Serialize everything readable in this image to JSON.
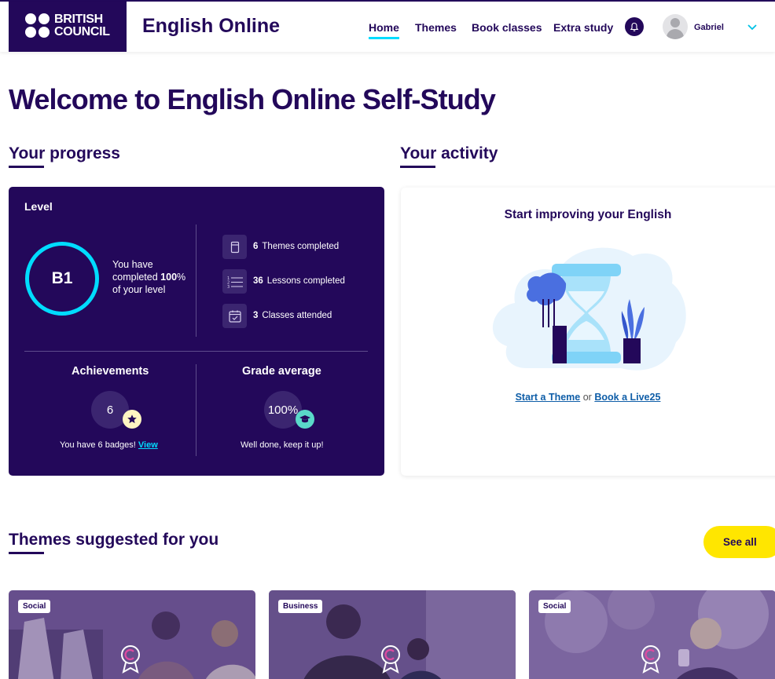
{
  "header": {
    "logo_line1": "BRITISH",
    "logo_line2": "COUNCIL",
    "app_title": "English Online",
    "nav": [
      {
        "label": "Home",
        "active": true
      },
      {
        "label": "Themes"
      },
      {
        "label": "Book classes"
      },
      {
        "label": "Extra study"
      }
    ],
    "user_name": "Gabriel"
  },
  "page_title": "Welcome to English Online Self-Study",
  "progress": {
    "heading": "Your progress",
    "level_label": "Level",
    "level": "B1",
    "completed_pre": "You have completed",
    "completed_pct": "100",
    "completed_post": "% of your level",
    "stats": [
      {
        "value": "6",
        "label": "Themes completed",
        "icon": "book-icon"
      },
      {
        "value": "36",
        "label": "Lessons completed",
        "icon": "list-icon"
      },
      {
        "value": "3",
        "label": "Classes attended",
        "icon": "calendar-check-icon"
      }
    ],
    "achievements": {
      "title": "Achievements",
      "count": "6",
      "text": "You have 6 badges!",
      "link": "View"
    },
    "grade": {
      "title": "Grade average",
      "value": "100%",
      "text": "Well done, keep it up!"
    }
  },
  "activity": {
    "heading": "Your activity",
    "title": "Start improving your English",
    "link1": "Start a Theme",
    "or": "or",
    "link2": "Book a Live25"
  },
  "themes": {
    "heading": "Themes suggested for you",
    "see_all": "See all",
    "cards": [
      {
        "tag": "Social"
      },
      {
        "tag": "Business"
      },
      {
        "tag": "Social"
      }
    ]
  },
  "colors": {
    "brand": "#23085a",
    "accent": "#00dcff",
    "button": "#ffe600",
    "link": "#0f5ea8"
  }
}
